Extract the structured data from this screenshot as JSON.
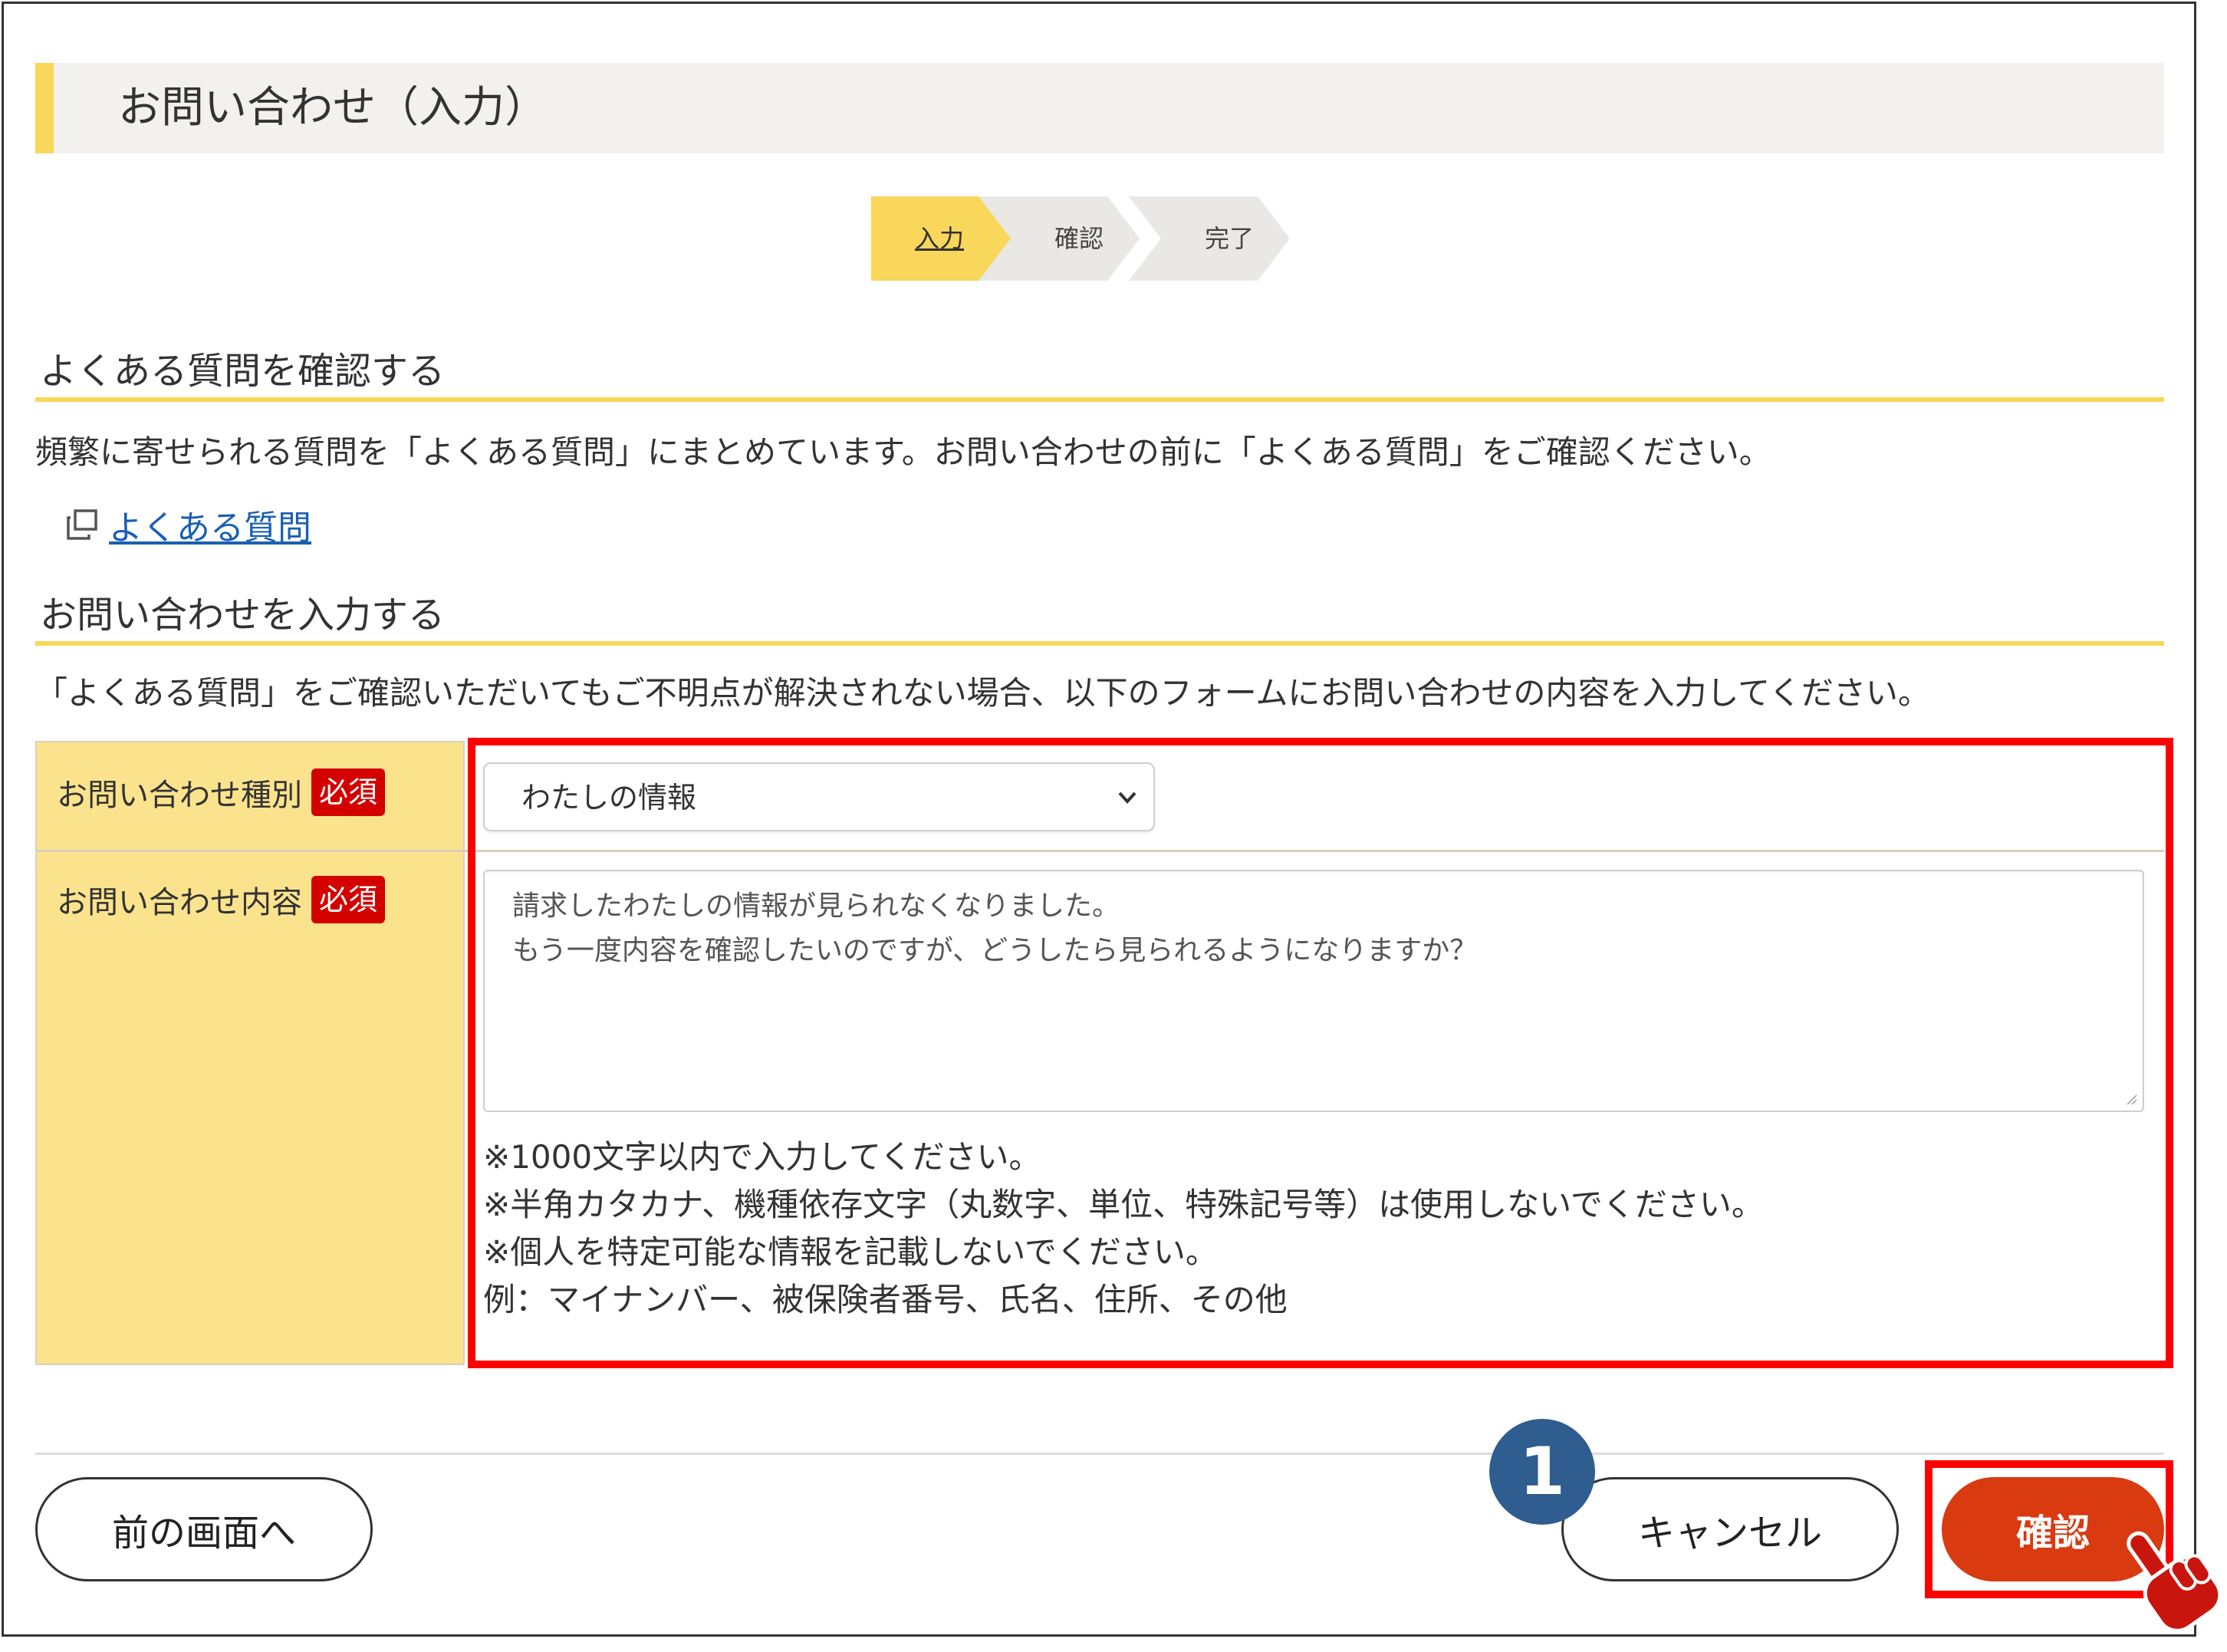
{
  "header": {
    "title": "お問い合わせ（入力）"
  },
  "steps": [
    {
      "label": "入力",
      "state": "current"
    },
    {
      "label": "確認",
      "state": "upcoming"
    },
    {
      "label": "完了",
      "state": "upcoming"
    }
  ],
  "faq_section": {
    "heading": "よくある質問を確認する",
    "description": "頻繁に寄せられる質問を「よくある質問」にまとめています。お問い合わせの前に「よくある質問」をご確認ください。",
    "link_label": "よくある質問",
    "link_icon": "external-window-icon"
  },
  "inquiry_section": {
    "heading": "お問い合わせを入力する",
    "description": "「よくある質問」をご確認いただいてもご不明点が解決されない場合、以下のフォームにお問い合わせの内容を入力してください。"
  },
  "form": {
    "type_label": "お問い合わせ種別",
    "content_label": "お問い合わせ内容",
    "required_badge": "必須",
    "type_value": "わたしの情報",
    "content_lines": [
      "請求したわたしの情報が見られなくなりました。",
      "もう一度内容を確認したいのですが、どうしたら見られるようになりますか？"
    ],
    "notes": [
      "※1000文字以内で入力してください。",
      "※半角カタカナ、機種依存文字（丸数字、単位、特殊記号等）は使用しないでください。",
      "※個人を特定可能な情報を記載しないでください。",
      "例：マイナンバー、被保険者番号、氏名、住所、その他"
    ]
  },
  "buttons": {
    "prev": "前の画面へ",
    "cancel": "キャンセル",
    "confirm": "確認"
  },
  "annotation": {
    "step_number": "1"
  },
  "colors": {
    "accent_yellow": "#f8d75a",
    "label_bg": "#fbe38e",
    "confirm_button": "#d93a10",
    "highlight_red": "#ff0000",
    "required_badge": "#d40000",
    "badge_blue": "#2f5d8f",
    "link_blue": "#1a5fb4"
  }
}
